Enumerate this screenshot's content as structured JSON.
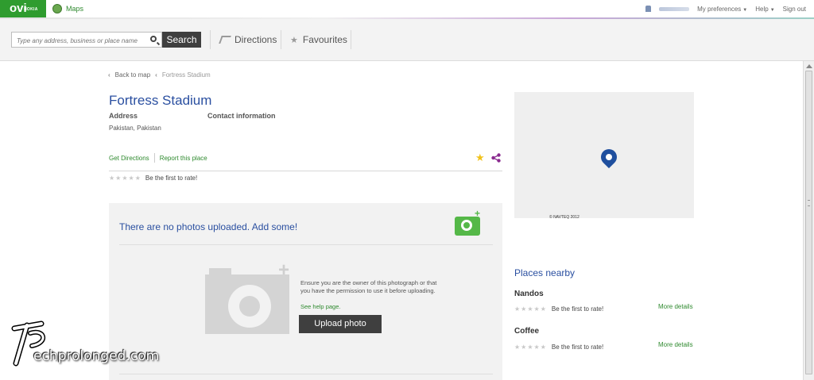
{
  "header": {
    "logo_text": "ovi",
    "logo_sub": "NOKIA",
    "maps_tab": "Maps",
    "my_preferences": "My preferences",
    "help": "Help",
    "sign_out": "Sign out"
  },
  "toolbar": {
    "search_placeholder": "Type any address, business or place name",
    "search_button": "Search",
    "directions": "Directions",
    "favourites": "Favourites"
  },
  "breadcrumb": {
    "back": "Back to map",
    "current": "Fortress Stadium"
  },
  "place": {
    "title": "Fortress Stadium",
    "address_label": "Address",
    "contact_label": "Contact information",
    "address_value": "Pakistan, Pakistan",
    "get_directions": "Get Directions",
    "report": "Report this place",
    "rating_text": "Be the first to rate!"
  },
  "photos": {
    "title": "There are no photos uploaded. Add some!",
    "notice": "Ensure you are the owner of this photograph or that you have the permission to use it before uploading.",
    "help_link": "See help page.",
    "upload_button": "Upload photo"
  },
  "map": {
    "copyright": "© NAVTEQ 2012"
  },
  "nearby": {
    "title": "Places nearby",
    "items": [
      {
        "name": "Nandos",
        "rating_text": "Be the first to rate!",
        "more": "More details"
      },
      {
        "name": "Coffee",
        "rating_text": "Be the first to rate!",
        "more": "More details"
      }
    ]
  },
  "watermark": {
    "initials": "TP",
    "text": "echprolonged.com"
  },
  "colors": {
    "brand_green": "#2f9c2f",
    "title_blue": "#2a4fa0",
    "link_green": "#2f8a2f",
    "star_gold": "#f1c21b"
  }
}
